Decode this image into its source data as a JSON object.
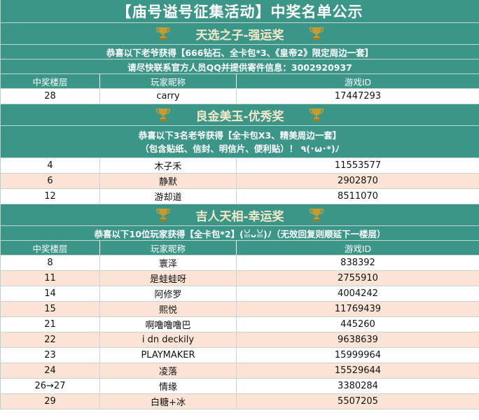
{
  "title": "【庙号谥号征集活动】中奖名单公示",
  "sections": [
    {
      "award": "天选之子-强运奖",
      "notices": [
        "恭喜以下老爷获得【666钻石、全卡包*3、《皇帝2》限定周边一套】",
        "请尽快联系官方人员QQ并提供寄件信息：3002920937"
      ],
      "headers": [
        "中奖楼层",
        "玩家昵称",
        "游戏ID"
      ],
      "rows": [
        [
          "28",
          "carry",
          "17447293"
        ]
      ]
    },
    {
      "award": "良金美玉-优秀奖",
      "notices": [
        "恭喜以下3名老爷获得【全卡包X3、精美周边一套】",
        "（包含贴纸、信封、明信片、便利贴）！ ٩(･ω･*)ﾉ"
      ],
      "rows": [
        [
          "4",
          "木子禾",
          "11553577"
        ],
        [
          "6",
          "静默",
          "2902870"
        ],
        [
          "12",
          "游却道",
          "8511070"
        ]
      ]
    },
    {
      "award": "吉人天相-幸运奖",
      "notices": [
        "恭喜以下10位玩家获得【全卡包*2】(ꈍᴗꈍ)ﾉ（无效回复则顺延下一楼层）"
      ],
      "headers": [
        "中奖楼层",
        "玩家昵称",
        "游戏ID"
      ],
      "rows": [
        [
          "8",
          "寰泽",
          "838392"
        ],
        [
          "11",
          "是蛙蛙呀",
          "2755910"
        ],
        [
          "14",
          "阿修罗",
          "4004242"
        ],
        [
          "15",
          "熙悦",
          "11769439"
        ],
        [
          "21",
          "啊噜噜噜巴",
          "445260"
        ],
        [
          "22",
          "i dn deckily",
          "9638639"
        ],
        [
          "23",
          "PLAYMAKER",
          "15999964"
        ],
        [
          "24",
          "凌落",
          "15529644"
        ],
        [
          "26→27",
          "情缘",
          "3380284"
        ],
        [
          "29",
          "白糖+冰",
          "5507205"
        ]
      ]
    }
  ],
  "colors": {
    "header_green": "#3b9687",
    "row_peach": "#fbe4d6",
    "award_text": "#f3e8c9"
  }
}
